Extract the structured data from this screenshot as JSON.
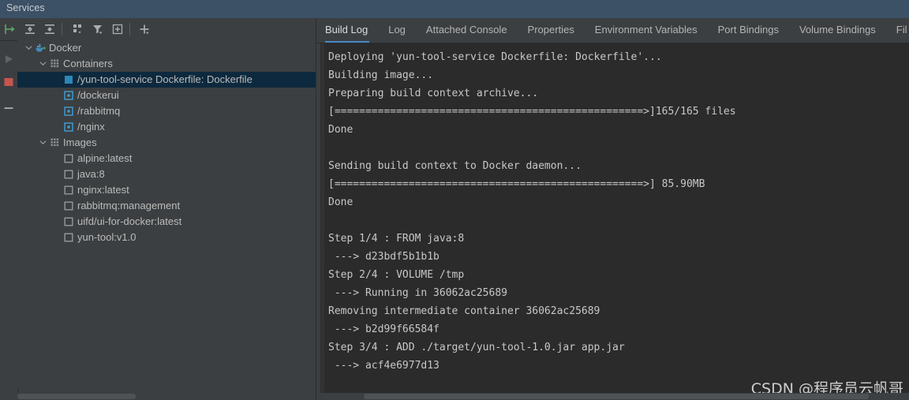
{
  "window": {
    "title": "Services"
  },
  "left_strip": {
    "items": [
      {
        "name": "edit-configuration-icon",
        "glyph": "pencil"
      },
      {
        "name": "run-icon",
        "glyph": "play"
      },
      {
        "name": "stop-icon",
        "glyph": "stop"
      },
      {
        "name": "collapse-icon",
        "glyph": "minus"
      }
    ]
  },
  "toolbar": {
    "items": [
      {
        "name": "connect-icon",
        "glyph": "green-arrow"
      },
      {
        "name": "expand-all-icon",
        "glyph": "expand-all"
      },
      {
        "name": "collapse-all-icon",
        "glyph": "collapse-all"
      },
      {
        "name": "group-by-icon",
        "glyph": "group-by"
      },
      {
        "name": "filter-icon",
        "glyph": "filter"
      },
      {
        "name": "add-tab-icon",
        "glyph": "add-tab"
      },
      {
        "name": "add-icon",
        "glyph": "plus"
      }
    ]
  },
  "tree": {
    "nodes": [
      {
        "label": "Docker",
        "depth": 0,
        "icon": "docker-whale",
        "expanded": true,
        "selected": false
      },
      {
        "label": "Containers",
        "depth": 1,
        "icon": "containers-grid",
        "expanded": true,
        "selected": false
      },
      {
        "label": "/yun-tool-service Dockerfile: Dockerfile",
        "depth": 2,
        "icon": "container-running",
        "expanded": null,
        "selected": true
      },
      {
        "label": "/dockerui",
        "depth": 2,
        "icon": "container-stopped",
        "expanded": null,
        "selected": false
      },
      {
        "label": "/rabbitmq",
        "depth": 2,
        "icon": "container-stopped",
        "expanded": null,
        "selected": false
      },
      {
        "label": "/nginx",
        "depth": 2,
        "icon": "container-stopped",
        "expanded": null,
        "selected": false
      },
      {
        "label": "Images",
        "depth": 1,
        "icon": "images-grid",
        "expanded": true,
        "selected": false
      },
      {
        "label": "alpine:latest",
        "depth": 2,
        "icon": "image-square",
        "expanded": null,
        "selected": false
      },
      {
        "label": "java:8",
        "depth": 2,
        "icon": "image-square",
        "expanded": null,
        "selected": false
      },
      {
        "label": "nginx:latest",
        "depth": 2,
        "icon": "image-square",
        "expanded": null,
        "selected": false
      },
      {
        "label": "rabbitmq:management",
        "depth": 2,
        "icon": "image-square",
        "expanded": null,
        "selected": false
      },
      {
        "label": "uifd/ui-for-docker:latest",
        "depth": 2,
        "icon": "image-square",
        "expanded": null,
        "selected": false
      },
      {
        "label": "yun-tool:v1.0",
        "depth": 2,
        "icon": "image-square",
        "expanded": null,
        "selected": false
      }
    ]
  },
  "tabs": {
    "items": [
      {
        "label": "Build Log",
        "active": true
      },
      {
        "label": "Log",
        "active": false
      },
      {
        "label": "Attached Console",
        "active": false
      },
      {
        "label": "Properties",
        "active": false
      },
      {
        "label": "Environment Variables",
        "active": false
      },
      {
        "label": "Port Bindings",
        "active": false
      },
      {
        "label": "Volume Bindings",
        "active": false
      },
      {
        "label": "Fil",
        "active": false
      }
    ]
  },
  "build_log": {
    "lines": [
      "Deploying 'yun-tool-service Dockerfile: Dockerfile'...",
      "Building image...",
      "Preparing build context archive...",
      "[==================================================>]165/165 files",
      "Done",
      "",
      "Sending build context to Docker daemon...",
      "[==================================================>] 85.90MB",
      "Done",
      "",
      "Step 1/4 : FROM java:8",
      " ---> d23bdf5b1b1b",
      "Step 2/4 : VOLUME /tmp",
      " ---> Running in 36062ac25689",
      "Removing intermediate container 36062ac25689",
      " ---> b2d99f66584f",
      "Step 3/4 : ADD ./target/yun-tool-1.0.jar app.jar",
      " ---> acf4e6977d13"
    ]
  },
  "watermark": {
    "text": "CSDN @程序员云帆哥"
  },
  "colors": {
    "title_bar": "#3c5066",
    "panel_bg": "#3c3f41",
    "console_bg": "#2b2b2b",
    "selection": "#0d293e",
    "tab_accent": "#4a88c7",
    "text": "#bbbbbb",
    "log_text": "#c8c8c8",
    "container_icon": "#389fd6",
    "stop_red": "#c75450",
    "run_green": "#59a869"
  }
}
